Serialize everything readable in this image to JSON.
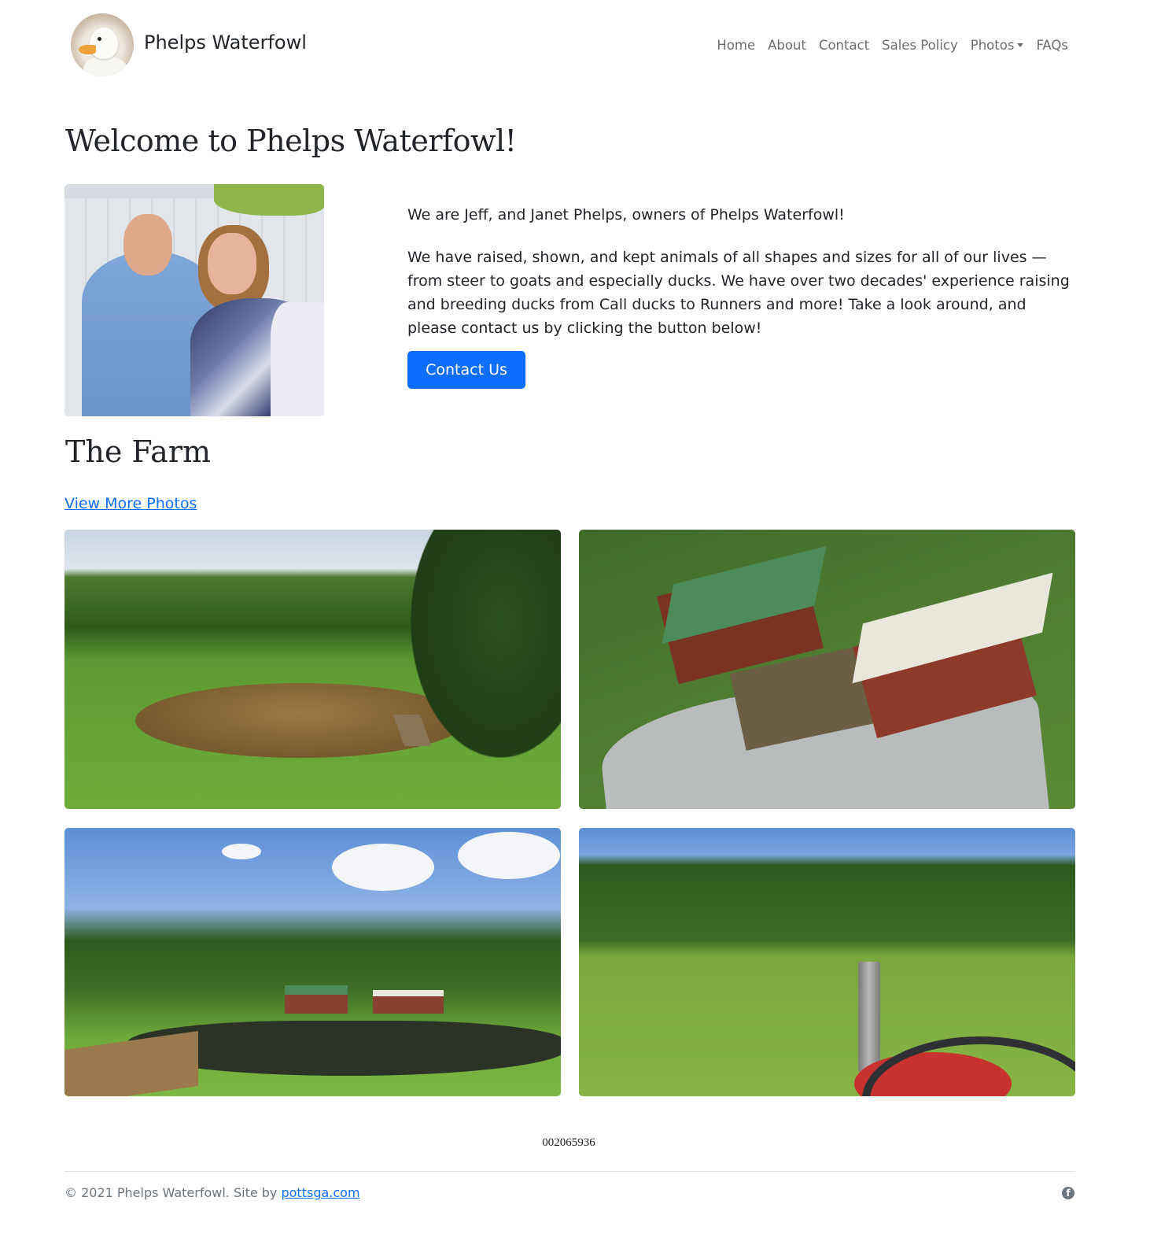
{
  "brand": {
    "name": "Phelps Waterfowl"
  },
  "nav": {
    "items": [
      {
        "label": "Home"
      },
      {
        "label": "About"
      },
      {
        "label": "Contact"
      },
      {
        "label": "Sales Policy"
      },
      {
        "label": "Photos",
        "has_dropdown": true
      },
      {
        "label": "FAQs"
      }
    ]
  },
  "welcome": {
    "heading": "Welcome to Phelps Waterfowl!",
    "intro_1": "We are Jeff, and Janet Phelps, owners of Phelps Waterfowl!",
    "intro_2": "We have raised, shown, and kept animals of all shapes and sizes for all of our lives — from steer to goats and especially ducks. We have over two decades' experience raising and breeding ducks from Call ducks to Runners and more! Take a look around, and please contact us by clicking the button below!",
    "contact_button": "Contact Us"
  },
  "farm": {
    "heading": "The Farm",
    "more_photos_link": "View More Photos"
  },
  "counter": "002065936",
  "footer": {
    "copyright": "© 2021 Phelps Waterfowl. Site by ",
    "credit_link": "pottsga.com",
    "social_icon": "facebook-icon"
  },
  "colors": {
    "primary": "#0d6efd",
    "text": "#212529",
    "muted": "#6c757d"
  }
}
